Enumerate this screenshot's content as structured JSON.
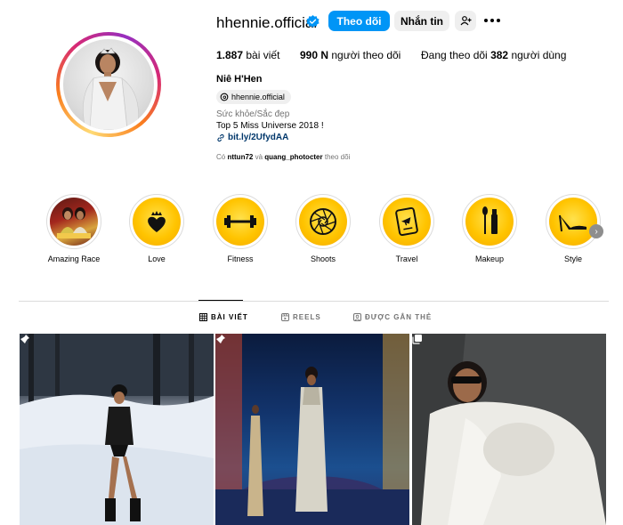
{
  "profile": {
    "username": "hhennie.official",
    "full_name": "Niê H'Hen",
    "threads_handle": "hhennie.official",
    "category": "Sức khỏe/Sắc đẹp",
    "bio": "Top 5 Miss Universe 2018 !",
    "link": "bit.ly/2UfydAA",
    "followed_by_prefix": "Có",
    "followed_by_1": "nttun72",
    "followed_by_and": "và",
    "followed_by_2": "quang_photocter",
    "followed_by_suffix": "theo dõi"
  },
  "actions": {
    "follow": "Theo dõi",
    "message": "Nhắn tin"
  },
  "stats": {
    "posts_count": "1.887",
    "posts_label": "bài viết",
    "followers_count": "990 N",
    "followers_label": "người theo dõi",
    "following_prefix": "Đang theo dõi",
    "following_count": "382",
    "following_label": "người dùng"
  },
  "highlights": [
    {
      "label": "Amazing Race",
      "icon": "photo-thumbnail"
    },
    {
      "label": "Love",
      "icon": "crowned-heart-icon"
    },
    {
      "label": "Fitness",
      "icon": "dumbbell-icon"
    },
    {
      "label": "Shoots",
      "icon": "camera-aperture-icon"
    },
    {
      "label": "Travel",
      "icon": "passport-icon"
    },
    {
      "label": "Makeup",
      "icon": "makeup-brush-icon"
    },
    {
      "label": "Style",
      "icon": "high-heel-icon"
    }
  ],
  "tabs": {
    "posts": "BÀI VIẾT",
    "reels": "REELS",
    "tagged": "ĐƯỢC GẮN THẺ"
  },
  "grid": [
    {
      "badge": "pin-icon"
    },
    {
      "badge": "pin-icon"
    },
    {
      "badge": "carousel-icon"
    }
  ],
  "colors": {
    "primary_button": "#0095f6",
    "secondary_button": "#efefef",
    "link": "#00376b",
    "muted_text": "#737373",
    "highlight_gold": "#ffc400"
  }
}
